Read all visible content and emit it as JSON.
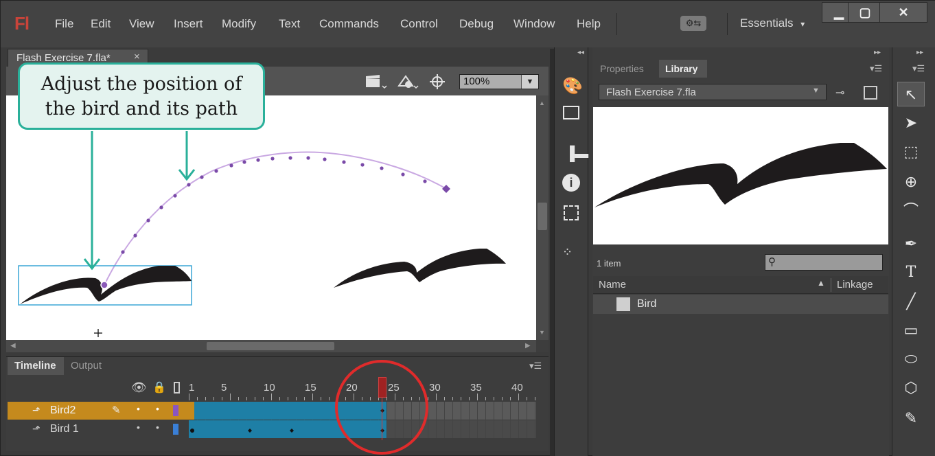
{
  "app": {
    "logo": "Fl",
    "menu": [
      "File",
      "Edit",
      "View",
      "Insert",
      "Modify",
      "Text",
      "Commands",
      "Control",
      "Debug",
      "Window",
      "Help"
    ],
    "workspace": "Essentials",
    "workspace_arrow": "▾",
    "sync_icon": "gears-icon",
    "window_buttons": {
      "minimize": "▁",
      "maximize": "▢",
      "close": "✕"
    }
  },
  "document": {
    "tab_title": "Flash Exercise 7.fla*",
    "tab_close": "×",
    "zoom": "100%",
    "zoom_arrow": "▼"
  },
  "callout": {
    "line1": "Adjust the position of",
    "line2": "the bird and its path"
  },
  "timeline": {
    "tabs": [
      "Timeline",
      "Output"
    ],
    "frame_numbers": [
      "1",
      "5",
      "10",
      "15",
      "20",
      "25",
      "30",
      "35",
      "40"
    ],
    "layers": [
      {
        "name": "Bird2",
        "selected": true
      },
      {
        "name": "Bird 1",
        "selected": false
      }
    ],
    "current_frame": 24,
    "last_frame": 24
  },
  "library": {
    "tabs": [
      "Properties",
      "Library"
    ],
    "active_tab": "Library",
    "document": "Flash Exercise 7.fla",
    "item_count": "1 item",
    "columns": {
      "name": "Name",
      "linkage": "Linkage"
    },
    "items": [
      {
        "name": "Bird",
        "icon": "movie-clip-icon"
      }
    ]
  },
  "tools": [
    "selection-tool",
    "subselection-tool",
    "free-transform-tool",
    "3d-rotation-tool",
    "lasso-tool",
    "pen-tool",
    "text-tool",
    "line-tool",
    "rectangle-tool",
    "oval-tool",
    "polystar-tool",
    "pencil-tool"
  ],
  "colors": {
    "accent_callout": "#2ab09a",
    "selected_layer": "#c58a1d",
    "tween_span": "#1e7fa6",
    "highlight_circle": "#e02b2b",
    "motion_path": "#9b6ec2"
  }
}
